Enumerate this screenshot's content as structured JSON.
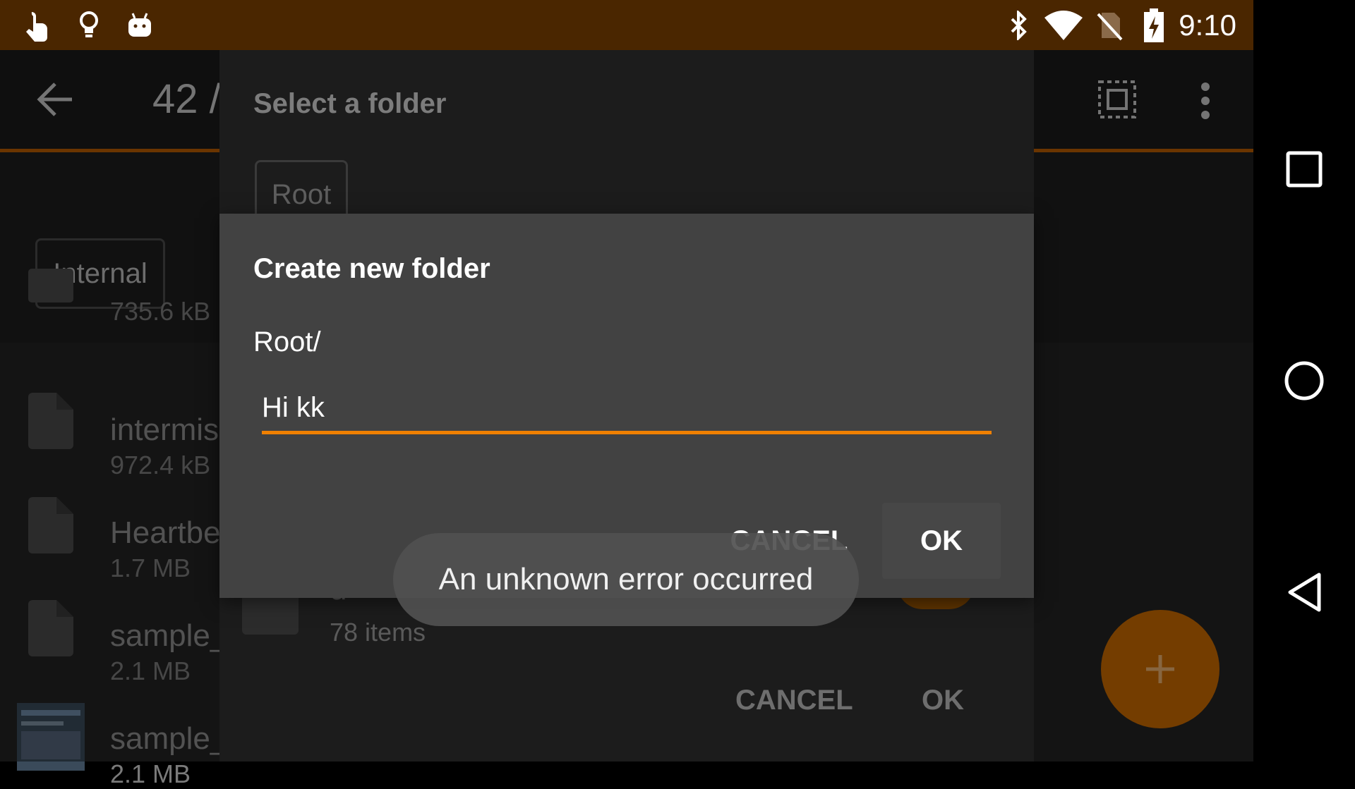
{
  "status_bar": {
    "time": "9:10",
    "left_icons": [
      "touch-icon",
      "lightbulb-icon",
      "android-icon"
    ],
    "right_icons": [
      "bluetooth-icon",
      "wifi-icon",
      "no-sim-icon",
      "battery-charging-icon"
    ]
  },
  "toolbar": {
    "title": "42 /",
    "back_icon": "arrow-back-icon",
    "select_all_icon": "select-all-icon",
    "overflow_icon": "more-vert-icon"
  },
  "storage_chip": "Internal",
  "files": [
    {
      "name": "",
      "size": "735.6 kB",
      "type": "folder"
    },
    {
      "name": "intermis",
      "size": "972.4 kB",
      "type": "file"
    },
    {
      "name": "Heartbe",
      "size": "1.7 MB",
      "type": "file"
    },
    {
      "name": "sample_",
      "size": "2.1 MB",
      "type": "file"
    },
    {
      "name": "sample_",
      "size": "2.1 MB",
      "type": "image"
    }
  ],
  "select_dialog": {
    "title": "Select a folder",
    "breadcrumb": "Root",
    "folder": {
      "name": "d",
      "count": "78 items"
    },
    "cancel": "CANCEL",
    "ok": "OK"
  },
  "create_dialog": {
    "title": "Create new folder",
    "path": "Root/",
    "input_value": "Hi kk",
    "cancel": "CANCEL",
    "ok": "OK"
  },
  "toast": "An unknown error occurred",
  "colors": {
    "status_bar": "#4a2600",
    "accent": "#f08000",
    "fab": "#c86a00"
  }
}
